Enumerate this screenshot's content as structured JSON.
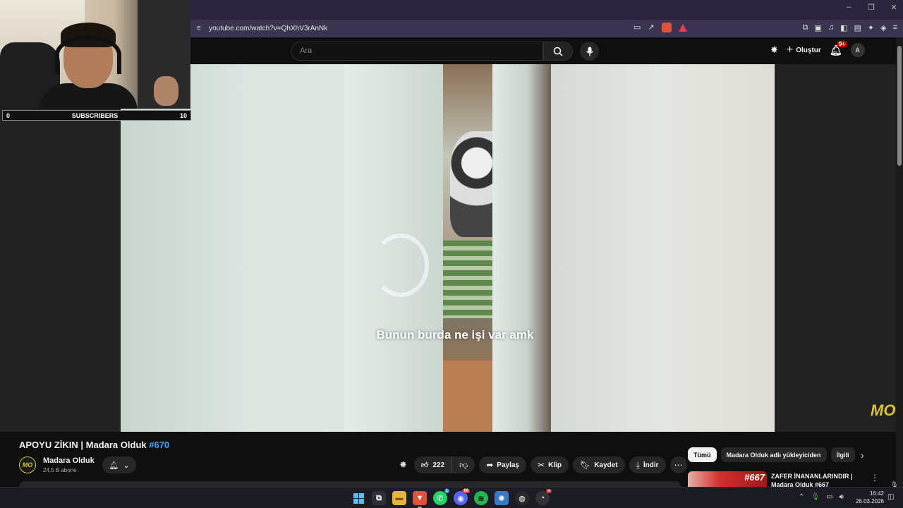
{
  "browser": {
    "url": "youtube.com/watch?v=QhXhV3rAnNk",
    "window_controls": [
      "–",
      "❐",
      "✕"
    ]
  },
  "youtube_header": {
    "search_placeholder": "Ara",
    "create_label": "Oluştur",
    "notification_count": "9+",
    "avatar_letter": "A"
  },
  "webcam": {
    "sub_left": "0",
    "sub_label": "SUBSCRIBERS",
    "sub_right": "10"
  },
  "video": {
    "caption": "Bunun burda ne işi var amk",
    "watermark": "MO"
  },
  "video_info": {
    "title": "APOYU ZİKIN | Madara Olduk ",
    "title_tag": "#670",
    "channel_name": "Madara Olduk",
    "channel_subs": "24,5 B abone",
    "channel_avatar_text": "MO",
    "like_count": "222",
    "share_label": "Paylaş",
    "clip_label": "Klip",
    "save_label": "Kaydet",
    "download_label": "İndir"
  },
  "sidebar": {
    "chips": [
      "Tümü",
      "Madara Olduk adlı yükleyiciden",
      "İlgili"
    ],
    "rec_number": "#667",
    "rec_title": "ZAFER İNANANLARINDIR | Madara Olduk #667"
  },
  "taskbar": {
    "time": "16:42",
    "date": "26.03.2026"
  }
}
